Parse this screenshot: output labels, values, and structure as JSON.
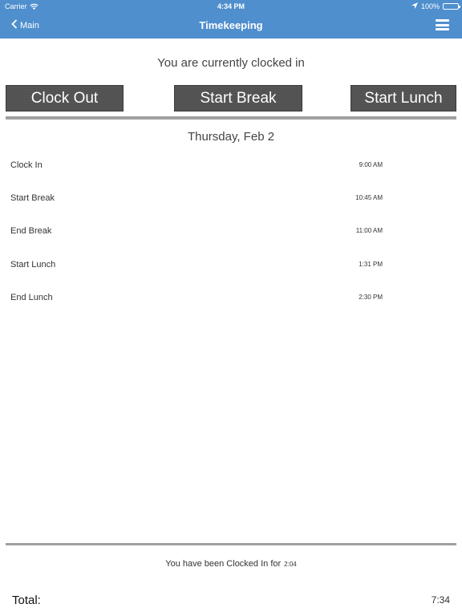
{
  "status_bar": {
    "carrier": "Carrier",
    "time": "4:34 PM",
    "battery": "100%",
    "icons": [
      "wifi-icon",
      "location-arrow-icon",
      "battery-icon"
    ]
  },
  "nav": {
    "back_label": "Main",
    "title": "Timekeeping",
    "icons": [
      "chevron-left-icon",
      "hamburger-menu-icon"
    ],
    "header_color": "#4f8fce"
  },
  "status_message": "You are currently clocked in",
  "actions": {
    "clock_out": "Clock Out",
    "start_break": "Start Break",
    "start_lunch": "Start Lunch",
    "button_color": "#505050"
  },
  "date_heading": "Thursday, Feb 2",
  "events": [
    {
      "label": "Clock In",
      "time": "9:00 AM"
    },
    {
      "label": "Start Break",
      "time": "10:45 AM"
    },
    {
      "label": "End Break",
      "time": "11:00 AM"
    },
    {
      "label": "Start Lunch",
      "time": "1:31 PM"
    },
    {
      "label": "End Lunch",
      "time": "2:30 PM"
    }
  ],
  "footer": {
    "clocked_in_text": "You have been Clocked In for",
    "clocked_in_duration": "2:04",
    "total_label": "Total:",
    "total_value": "7:34"
  }
}
